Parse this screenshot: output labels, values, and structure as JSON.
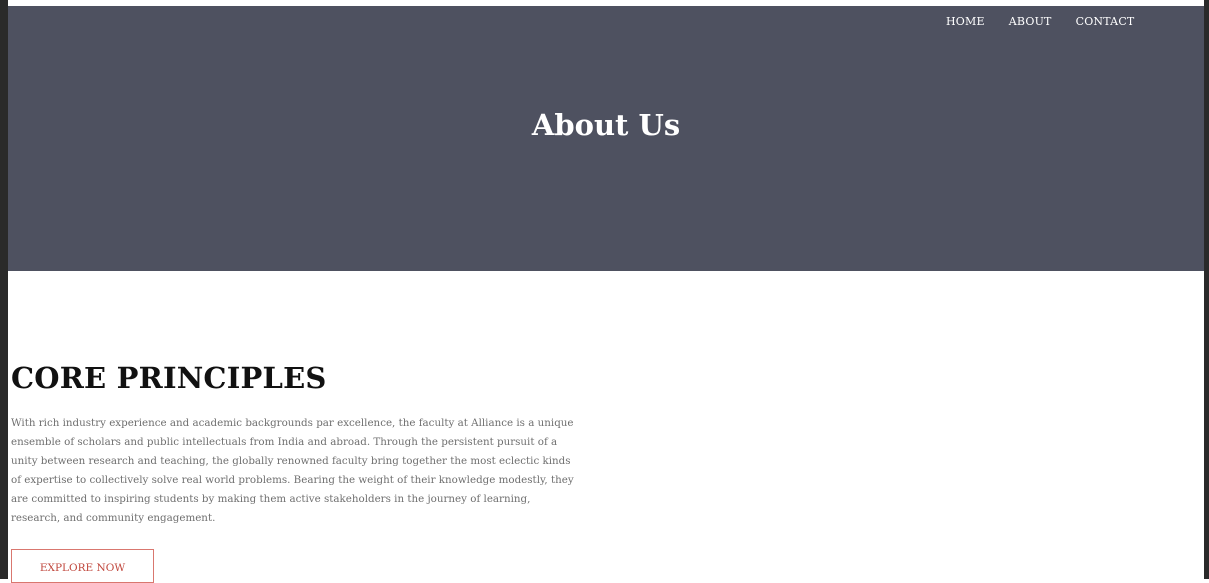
{
  "nav": {
    "items": [
      {
        "label": "HOME"
      },
      {
        "label": "ABOUT"
      },
      {
        "label": "CONTACT"
      }
    ]
  },
  "hero": {
    "title": "About Us",
    "background_color": "#4e5160"
  },
  "principles": {
    "heading": "CORE PRINCIPLES",
    "body": "With rich industry experience and academic backgrounds par excellence, the faculty at Alliance is a unique ensemble of scholars and public intellectuals from India and abroad. Through the persistent pursuit of a unity between research and teaching, the globally renowned faculty bring together the most eclectic kinds of expertise to collectively solve real world problems. Bearing the weight of their knowledge modestly, they are committed to inspiring students by making them active stakeholders in the journey of learning, research, and community engagement.",
    "cta_label": "EXPLORE NOW",
    "cta_color": "#c0473d"
  }
}
